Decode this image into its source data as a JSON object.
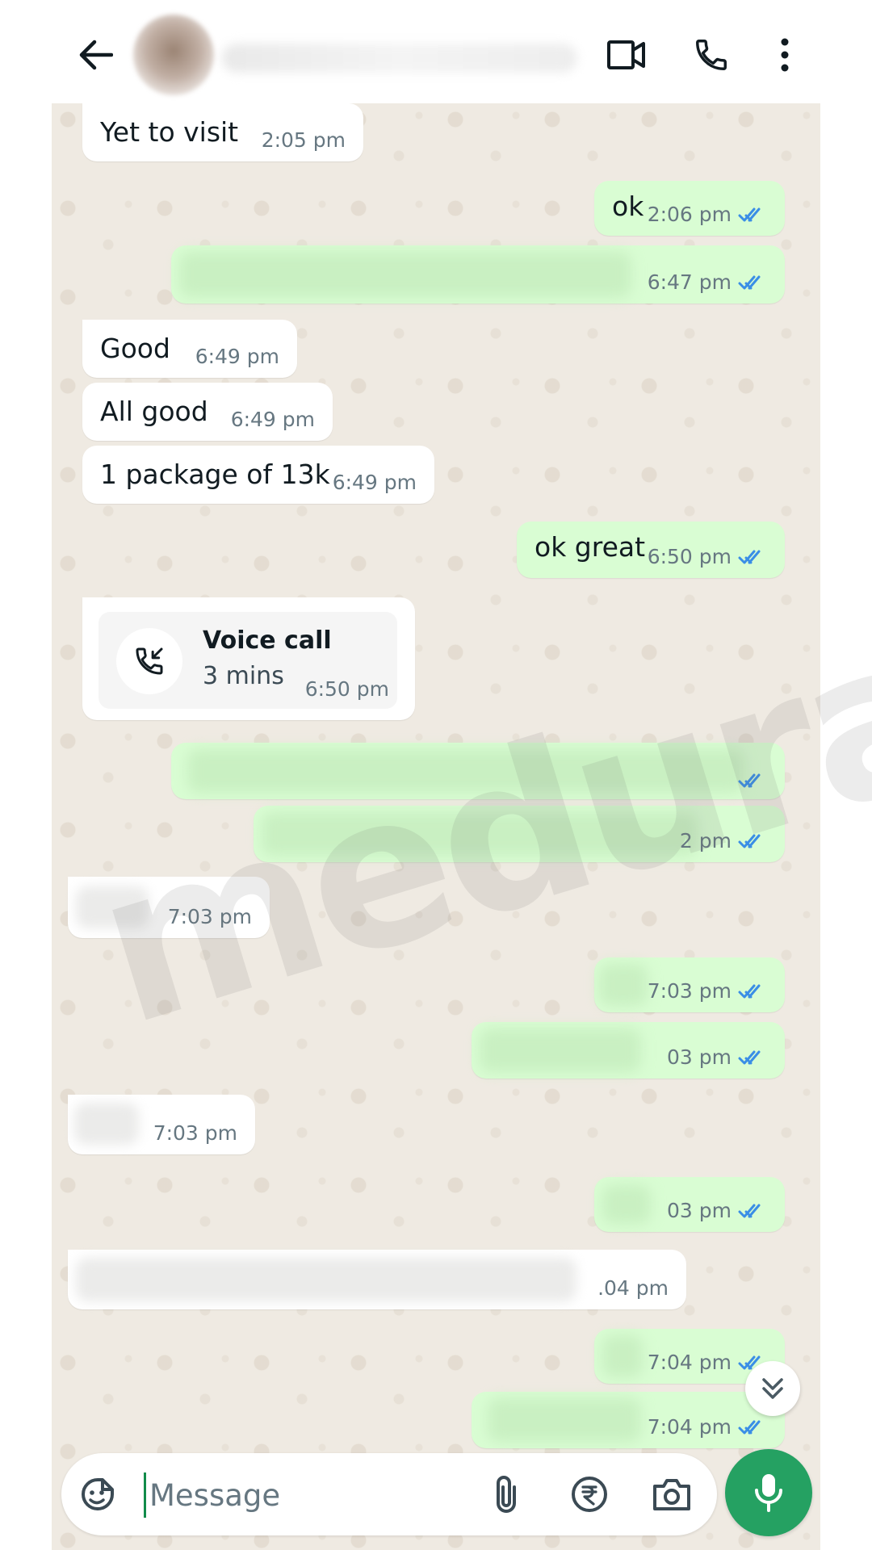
{
  "header": {
    "back_icon": "arrow-left-icon",
    "video_icon": "video-camera-icon",
    "call_icon": "phone-icon",
    "menu_icon": "more-vertical-icon"
  },
  "colors": {
    "incoming_bubble": "#ffffff",
    "outgoing_bubble": "#d9fdd3",
    "chat_background": "#efeae2",
    "read_ticks": "#3a8ee6",
    "accent_green": "#25a162"
  },
  "messages": [
    {
      "direction": "in",
      "text": "Yet to visit",
      "time": "2:05 pm"
    },
    {
      "direction": "out",
      "text": "ok",
      "time": "2:06 pm",
      "status": "read"
    },
    {
      "direction": "out",
      "text": "",
      "time": "6:47 pm",
      "status": "read",
      "blurred": true
    },
    {
      "direction": "in",
      "text": "Good",
      "time": "6:49 pm"
    },
    {
      "direction": "in",
      "text": "All good",
      "time": "6:49 pm"
    },
    {
      "direction": "in",
      "text": "1 package of 13k",
      "time": "6:49 pm"
    },
    {
      "direction": "out",
      "text": "ok great",
      "time": "6:50 pm",
      "status": "read"
    },
    {
      "direction": "in",
      "type": "call",
      "call_title": "Voice call",
      "call_duration": "3 mins",
      "time": "6:50 pm"
    },
    {
      "direction": "out",
      "text": "",
      "time": "",
      "status": "read",
      "blurred": true
    },
    {
      "direction": "out",
      "text": "",
      "time": "2 pm",
      "status": "read",
      "blurred": true
    },
    {
      "direction": "in",
      "text": "",
      "time": "7:03 pm",
      "blurred": true
    },
    {
      "direction": "out",
      "text": "",
      "time": "7:03 pm",
      "status": "read",
      "blurred": true
    },
    {
      "direction": "out",
      "text": "",
      "time": "03 pm",
      "status": "read",
      "blurred": true
    },
    {
      "direction": "in",
      "text": "",
      "time": "7:03 pm",
      "blurred": true
    },
    {
      "direction": "out",
      "text": "",
      "time": "03 pm",
      "status": "read",
      "blurred": true
    },
    {
      "direction": "in",
      "text": "",
      "time": ".04 pm",
      "blurred": true
    },
    {
      "direction": "out",
      "text": "",
      "time": "7:04 pm",
      "status": "read",
      "blurred": true
    },
    {
      "direction": "out",
      "text": "",
      "time": "7:04 pm",
      "status": "read",
      "blurred": true
    }
  ],
  "watermark": "medura",
  "composer": {
    "placeholder": "Message",
    "sticker_icon": "sticker-icon",
    "attach_icon": "paperclip-icon",
    "payment_icon": "rupee-icon",
    "camera_icon": "camera-icon",
    "mic_icon": "microphone-icon"
  },
  "scroll_button_icon": "double-chevron-down-icon"
}
